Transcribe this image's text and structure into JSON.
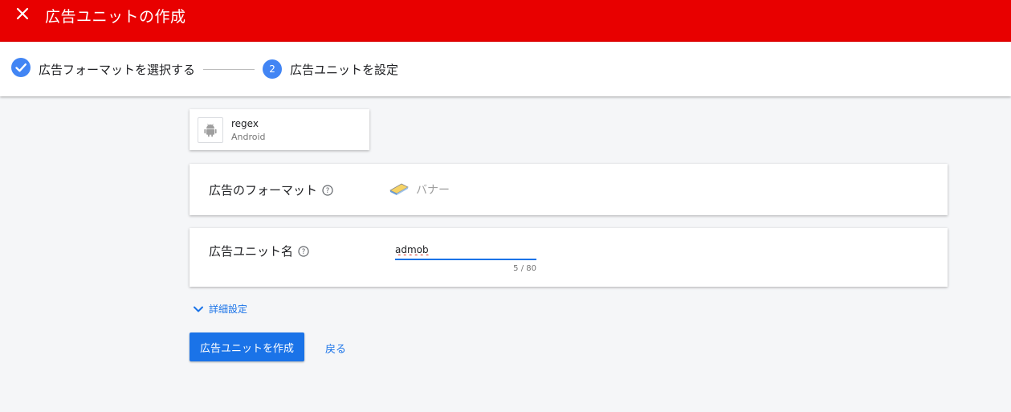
{
  "header": {
    "title": "広告ユニットの作成",
    "close_icon": "close-icon",
    "background_color": "#e80000"
  },
  "stepper": {
    "steps": [
      {
        "label": "広告フォーマットを選択する",
        "state": "completed",
        "icon": "check-circle-icon"
      },
      {
        "number": "2",
        "label": "広告ユニットを設定",
        "state": "active"
      }
    ],
    "accent_color": "#4285f4"
  },
  "app": {
    "name": "regex",
    "platform": "Android",
    "icon": "android-icon"
  },
  "format_panel": {
    "label": "広告のフォーマット",
    "help_icon": "help-icon",
    "value": "バナー",
    "value_icon": "banner-icon"
  },
  "name_panel": {
    "label": "広告ユニット名",
    "help_icon": "help-icon",
    "value": "admob",
    "counter": "5 / 80"
  },
  "advanced": {
    "label": "詳細設定",
    "icon": "chevron-down-icon"
  },
  "actions": {
    "create_label": "広告ユニットを作成",
    "back_label": "戻る",
    "primary_color": "#1a73e8"
  }
}
